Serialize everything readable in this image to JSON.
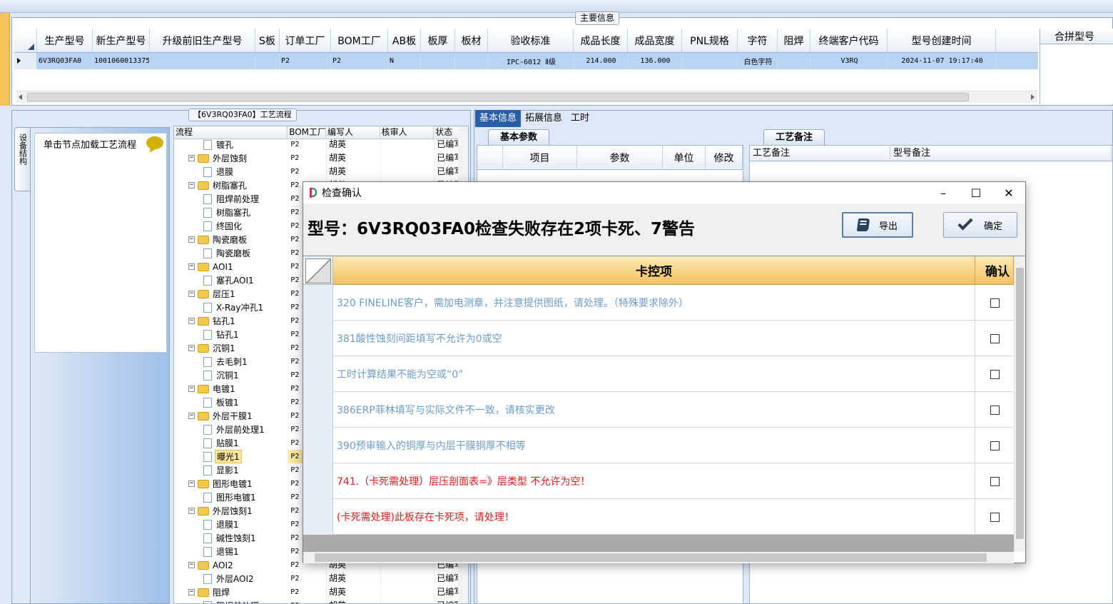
{
  "main_info": {
    "title": "主要信息",
    "columns": [
      "生产型号",
      "新生产型号",
      "升级前旧生产型号",
      "S板",
      "订单工厂",
      "BOM工厂",
      "AB板",
      "板厚",
      "板材",
      "验收标准",
      "成品长度",
      "成品宽度",
      "PNL规格",
      "字符",
      "阻焊",
      "终端客户代码",
      "型号创建时间"
    ],
    "row": [
      "6V3RQ03FA0",
      "10010600133759",
      "",
      "",
      "P2",
      "P2",
      "N",
      "",
      "",
      "IPC-6012 Ⅱ级",
      "214.000",
      "136.000",
      "",
      "白色字符",
      "",
      "V3RQ",
      "2024-11-07 19:17:40"
    ],
    "merge_title": "合拼型号"
  },
  "process": {
    "title": "【6V3RQ03FA0】工艺流程",
    "side_tab": "设备结构",
    "load_hint": "单击节点加载工艺流程",
    "columns": [
      "流程",
      "BOM工厂",
      "编写人",
      "核审人",
      "状态"
    ],
    "rows": [
      {
        "name": "镀孔",
        "level": 2,
        "bom": "P2",
        "writer": "胡英",
        "status": "已编写"
      },
      {
        "name": "外层蚀刻",
        "level": 1,
        "bom": "P2",
        "writer": "胡英",
        "status": "已编写"
      },
      {
        "name": "退膜",
        "level": 2,
        "bom": "P2",
        "writer": "胡英",
        "status": "已编写"
      },
      {
        "name": "树脂塞孔",
        "level": 1,
        "bom": "P2",
        "writer": "胡英",
        "status": "已编写"
      },
      {
        "name": "阻焊前处理",
        "level": 2,
        "bom": "P2",
        "writer": "",
        "status": ""
      },
      {
        "name": "树脂塞孔",
        "level": 2,
        "bom": "P2",
        "writer": "",
        "status": ""
      },
      {
        "name": "终固化",
        "level": 2,
        "bom": "P2",
        "writer": "",
        "status": ""
      },
      {
        "name": "陶瓷磨板",
        "level": 1,
        "bom": "P2",
        "writer": "",
        "status": ""
      },
      {
        "name": "陶瓷磨板",
        "level": 2,
        "bom": "P2",
        "writer": "",
        "status": ""
      },
      {
        "name": "AOI1",
        "level": 1,
        "bom": "P2",
        "writer": "",
        "status": ""
      },
      {
        "name": "塞孔AOI1",
        "level": 2,
        "bom": "P2",
        "writer": "",
        "status": ""
      },
      {
        "name": "层压1",
        "level": 1,
        "bom": "P2",
        "writer": "",
        "status": ""
      },
      {
        "name": "X-Ray冲孔1",
        "level": 2,
        "bom": "P2",
        "writer": "",
        "status": ""
      },
      {
        "name": "钻孔1",
        "level": 1,
        "bom": "P2",
        "writer": "",
        "status": ""
      },
      {
        "name": "钻孔1",
        "level": 2,
        "bom": "P2",
        "writer": "",
        "status": ""
      },
      {
        "name": "沉铜1",
        "level": 1,
        "bom": "P2",
        "writer": "",
        "status": ""
      },
      {
        "name": "去毛刺1",
        "level": 2,
        "bom": "P2",
        "writer": "",
        "status": ""
      },
      {
        "name": "沉铜1",
        "level": 2,
        "bom": "P2",
        "writer": "",
        "status": ""
      },
      {
        "name": "电镀1",
        "level": 1,
        "bom": "P2",
        "writer": "",
        "status": ""
      },
      {
        "name": "板镀1",
        "level": 2,
        "bom": "P2",
        "writer": "",
        "status": ""
      },
      {
        "name": "外层干膜1",
        "level": 1,
        "bom": "P2",
        "writer": "",
        "status": ""
      },
      {
        "name": "外层前处理1",
        "level": 2,
        "bom": "P2",
        "writer": "",
        "status": ""
      },
      {
        "name": "贴膜1",
        "level": 2,
        "bom": "P2",
        "writer": "",
        "status": ""
      },
      {
        "name": "曝光1",
        "level": 2,
        "bom": "P2",
        "writer": "",
        "status": "",
        "selected": true
      },
      {
        "name": "显影1",
        "level": 2,
        "bom": "P2",
        "writer": "",
        "status": ""
      },
      {
        "name": "图形电镀1",
        "level": 1,
        "bom": "P2",
        "writer": "",
        "status": ""
      },
      {
        "name": "图形电镀1",
        "level": 2,
        "bom": "P2",
        "writer": "",
        "status": ""
      },
      {
        "name": "外层蚀刻1",
        "level": 1,
        "bom": "P2",
        "writer": "",
        "status": ""
      },
      {
        "name": "退膜1",
        "level": 2,
        "bom": "P2",
        "writer": "",
        "status": ""
      },
      {
        "name": "碱性蚀刻1",
        "level": 2,
        "bom": "P2",
        "writer": "",
        "status": ""
      },
      {
        "name": "退锡1",
        "level": 2,
        "bom": "P2",
        "writer": "",
        "status": ""
      },
      {
        "name": "AOI2",
        "level": 1,
        "bom": "P2",
        "writer": "胡英",
        "status": "已编写"
      },
      {
        "name": "外层AOI2",
        "level": 2,
        "bom": "P2",
        "writer": "胡英",
        "status": "已编写"
      },
      {
        "name": "阻焊",
        "level": 1,
        "bom": "P2",
        "writer": "胡英",
        "status": "已编写"
      },
      {
        "name": "阻焊前处理",
        "level": 2,
        "bom": "P2",
        "writer": "胡英",
        "status": "已编写"
      }
    ]
  },
  "right_tabs": [
    "基本信息",
    "拓展信息",
    "工时"
  ],
  "basic_params": {
    "title": "基本参数",
    "columns": [
      "项目",
      "参数",
      "单位",
      "修改"
    ]
  },
  "remarks": {
    "title": "工艺备注",
    "columns": [
      "工艺备注",
      "型号备注"
    ]
  },
  "dialog": {
    "title": "检查确认",
    "headline": "型号：6V3RQ03FA0检查失败存在2项卡死、7警告",
    "export_label": "导出",
    "confirm_label": "确定",
    "col_item": "卡控项",
    "col_confirm": "确认",
    "items": [
      {
        "text": "320 FINELINE客户，需加电测章，并注意提供图纸，请处理。（特殊要求除外）",
        "severity": "warning"
      },
      {
        "text": "381酸性蚀刻间距填写不允许为0或空",
        "severity": "warning"
      },
      {
        "text": "工时计算结果不能为空或“0”",
        "severity": "warning"
      },
      {
        "text": "386ERP菲林填写与实际文件不一致，请核实更改",
        "severity": "warning"
      },
      {
        "text": "390预审输入的铜厚与内层干膜铜厚不相等",
        "severity": "warning"
      },
      {
        "text": "741.（卡死需处理）层压剖面表=》层类型 不允许为空！",
        "severity": "fatal"
      },
      {
        "text": "(卡死需处理)此板存在卡死项，请处理！",
        "severity": "fatal"
      }
    ],
    "colors": {
      "warning": "#6d9cc9",
      "fatal": "#e01b1b",
      "header": "#f3c260"
    }
  }
}
